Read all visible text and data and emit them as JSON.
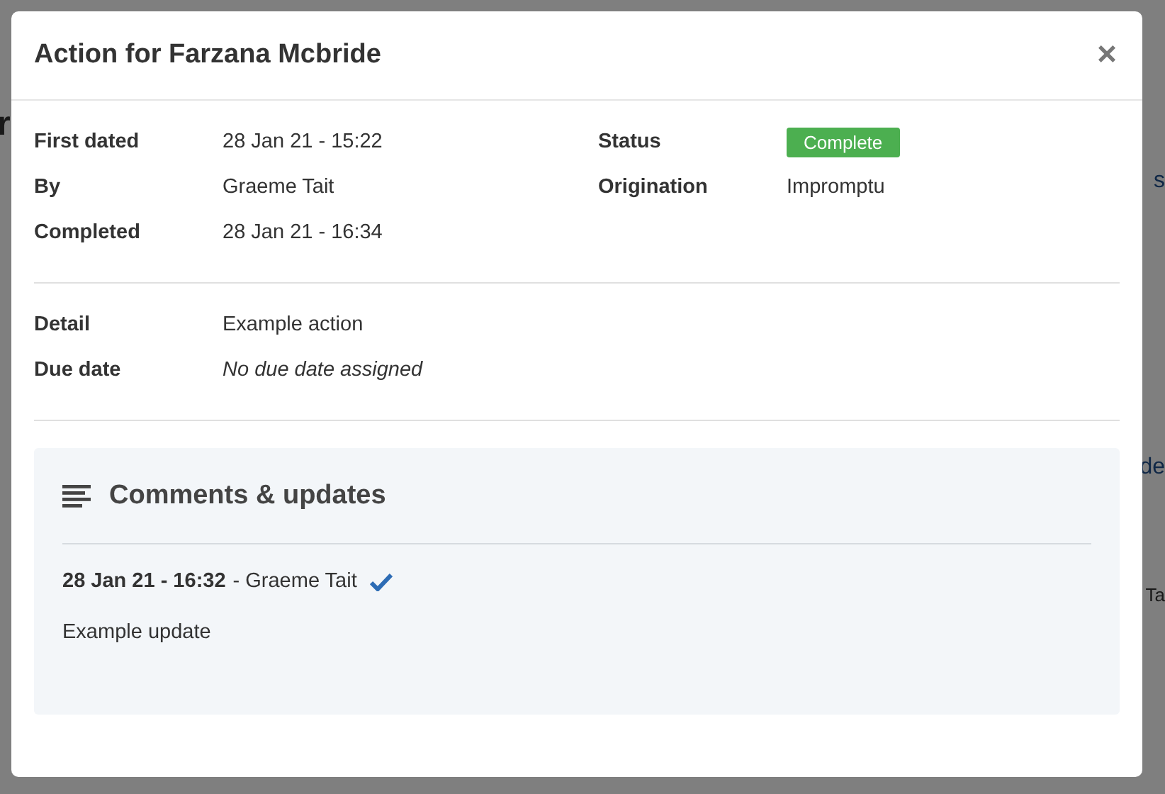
{
  "background_page": {
    "left_fragments": [
      {
        "text": "r",
        "kind": "heading"
      }
    ],
    "right_fragments": [
      {
        "text": "s",
        "kind": "link"
      },
      {
        "text": "de",
        "kind": "link"
      },
      {
        "text": "Ta",
        "kind": "plain"
      }
    ]
  },
  "dialog": {
    "title": "Action for Farzana Mcbride",
    "close": "×",
    "summary_left": [
      {
        "label": "First dated",
        "value": "28 Jan 21 - 15:22"
      },
      {
        "label": "By",
        "value": "Graeme Tait"
      },
      {
        "label": "Completed",
        "value": "28 Jan 21 - 16:34"
      }
    ],
    "summary_right": [
      {
        "label": "Status",
        "value": "Complete",
        "kind": "badge"
      },
      {
        "label": "Origination",
        "value": "Impromptu",
        "kind": "text"
      }
    ],
    "details": [
      {
        "label": "Detail",
        "value": "Example action",
        "kind": "text"
      },
      {
        "label": "Due date",
        "value": "No due date assigned",
        "kind": "empty"
      }
    ],
    "comments": {
      "title": "Comments & updates",
      "items": [
        {
          "date": "28 Jan 21 - 16:32",
          "author": "- Graeme Tait",
          "verified": true,
          "text": "Example update"
        }
      ]
    }
  }
}
